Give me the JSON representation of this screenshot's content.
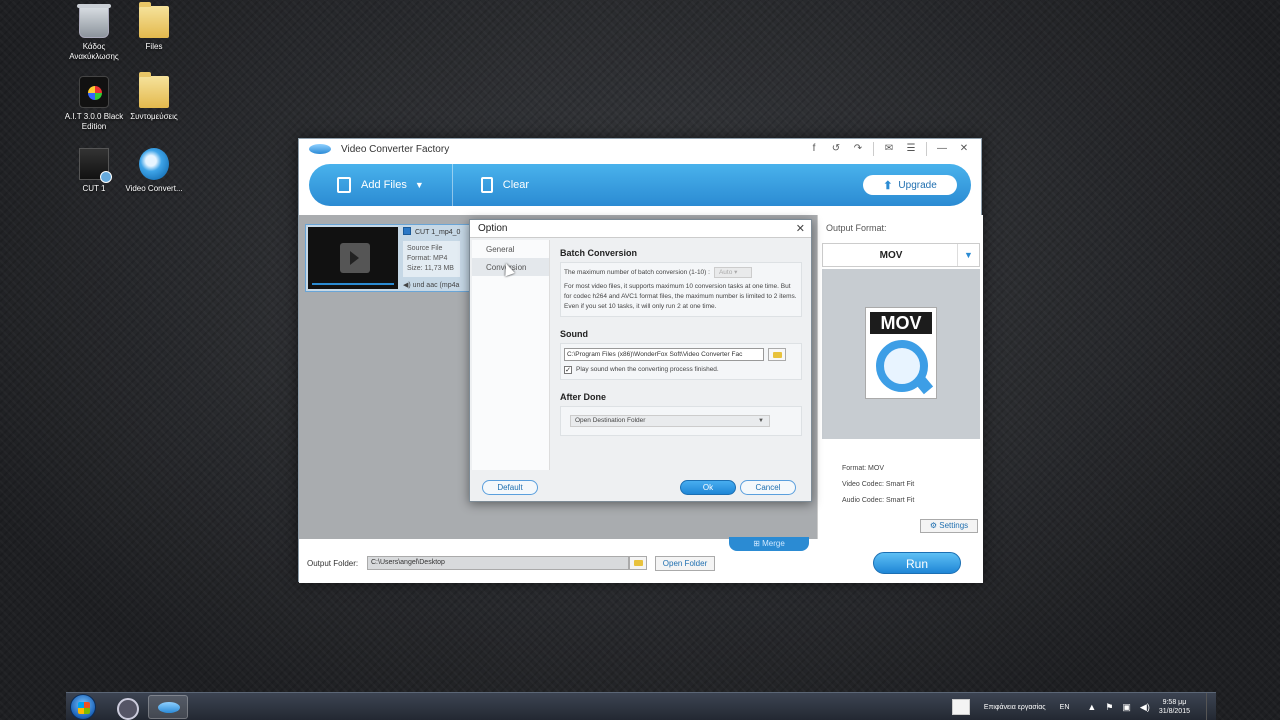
{
  "desktop": {
    "icons": [
      {
        "label": "Κάδος Ανακύκλωσης",
        "icon": "recycle-bin-icon"
      },
      {
        "label": "Files",
        "icon": "folder-icon"
      },
      {
        "label": "A.I.T 3.0.0 Black Edition",
        "icon": "app-icon"
      },
      {
        "label": "Συντομεύσεις",
        "icon": "folder-icon"
      },
      {
        "label": "CUT 1",
        "icon": "video-file-icon"
      },
      {
        "label": "Video Convert...",
        "icon": "video-converter-icon"
      }
    ]
  },
  "app": {
    "title": "Video Converter Factory",
    "toolbar": {
      "add_files": "Add Files",
      "clear": "Clear",
      "upgrade": "Upgrade"
    },
    "file": {
      "name": "CUT 1_mp4_0",
      "source_label": "Source File",
      "format": "Format: MP4",
      "size": "Size: 11,73 MB",
      "audio": "und aac (mp4a"
    },
    "output": {
      "label": "Output Format:",
      "format": "MOV",
      "preview_text": "MOV",
      "info_format": "Format: MOV",
      "info_video": "Video Codec: Smart Fit",
      "info_audio": "Audio Codec: Smart Fit",
      "settings": "Settings"
    },
    "bottom": {
      "merge": "Merge",
      "output_folder_label": "Output Folder:",
      "output_folder_value": "C:\\Users\\angel\\Desktop",
      "open_folder": "Open Folder",
      "run": "Run"
    }
  },
  "dialog": {
    "title": "Option",
    "sidebar": [
      "General",
      "Conversion"
    ],
    "active_tab": "Conversion",
    "batch": {
      "title": "Batch Conversion",
      "label": "The maximum number of batch conversion (1-10) :",
      "value": "Auto",
      "note": "For most video files, it supports maximum 10 conversion tasks at one time. But for codec h264 and AVC1 format files, the maximum number is limited to 2 items. Even if you set 10 tasks, it will only run 2 at one time."
    },
    "sound": {
      "title": "Sound",
      "path": "C:\\Program Files (x86)\\WonderFox Soft\\Video Converter Fac",
      "checkbox_label": "Play sound when the converting process finished.",
      "checked": true
    },
    "after_done": {
      "title": "After Done",
      "value": "Open Destination Folder"
    },
    "buttons": {
      "default": "Default",
      "ok": "Ok",
      "cancel": "Cancel"
    }
  },
  "taskbar": {
    "desktop_label": "Επιφάνεια εργασίας",
    "lang": "EN",
    "time": "9:58 μμ",
    "date": "31/8/2015"
  }
}
